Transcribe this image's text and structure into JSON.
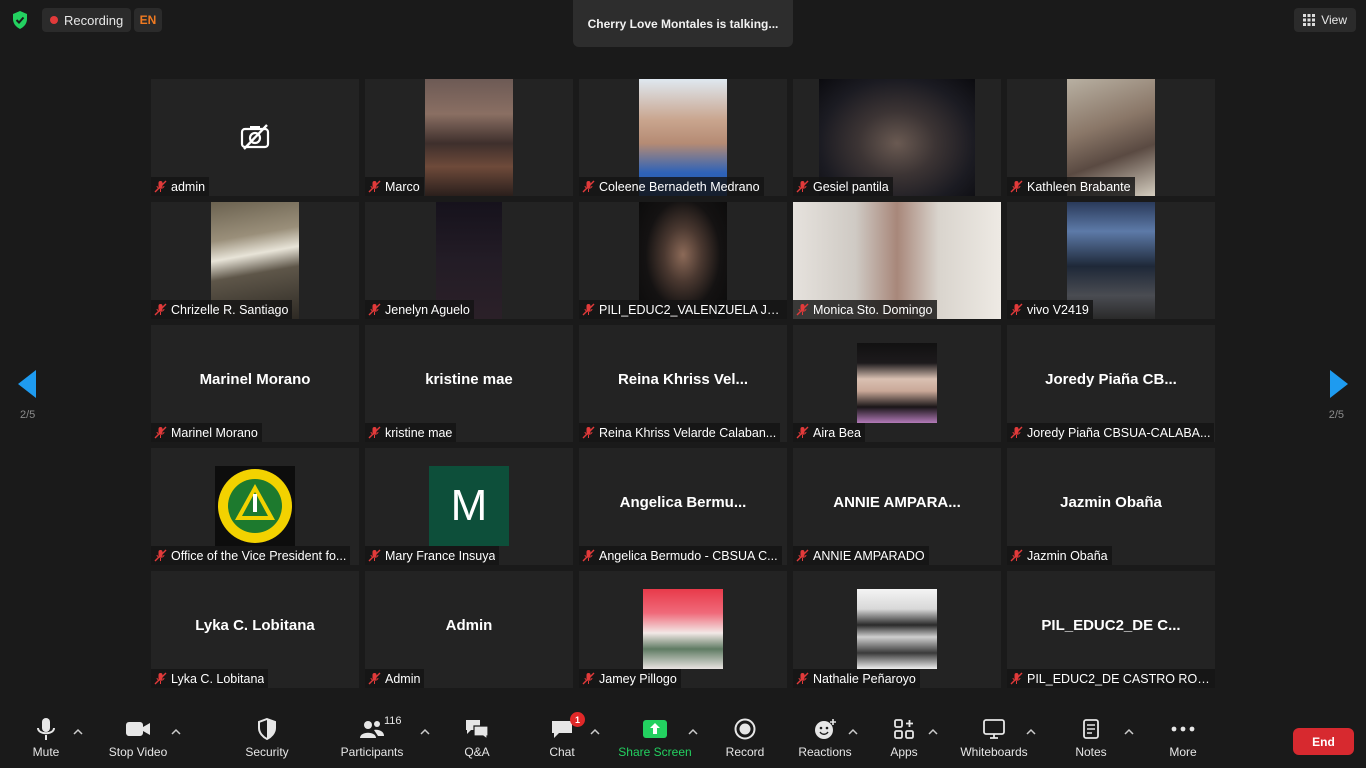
{
  "top": {
    "recording_label": "Recording",
    "language": "EN",
    "talking": "Cherry Love Montales is talking...",
    "view_label": "View"
  },
  "pagination": {
    "left": "2/5",
    "right": "2/5"
  },
  "tiles": [
    {
      "label": "admin"
    },
    {
      "label": "Marco"
    },
    {
      "label": "Coleene Bernadeth Medrano"
    },
    {
      "label": "Gesiel pantila"
    },
    {
      "label": "Kathleen Brabante"
    },
    {
      "label": "Chrizelle R. Santiago"
    },
    {
      "label": "Jenelyn Aguelo"
    },
    {
      "label": "PILI_EDUC2_VALENZUELA JHO..."
    },
    {
      "label": "Monica Sto. Domingo"
    },
    {
      "label": "vivo V2419"
    },
    {
      "big": "Marinel Morano",
      "label": "Marinel Morano"
    },
    {
      "big": "kristine mae",
      "label": "kristine mae"
    },
    {
      "big": "Reina Khriss Vel...",
      "label": "Reina Khriss Velarde Calaban..."
    },
    {
      "label": "Aira Bea"
    },
    {
      "big": "Joredy Piaña CB...",
      "label": "Joredy Piaña CBSUA-CALABA..."
    },
    {
      "label": "Office of the Vice President fo..."
    },
    {
      "avatar_letter": "M",
      "label": "Mary France Insuya"
    },
    {
      "big": "Angelica Bermu...",
      "label": "Angelica Bermudo - CBSUA C..."
    },
    {
      "big": "ANNIE AMPARA...",
      "label": "ANNIE AMPARADO"
    },
    {
      "big": "Jazmin Obaña",
      "label": "Jazmin Obaña"
    },
    {
      "big": "Lyka C. Lobitana",
      "label": "Lyka C. Lobitana"
    },
    {
      "big": "Admin",
      "label": "Admin"
    },
    {
      "label": "Jamey Pillogo"
    },
    {
      "label": "Nathalie Peñaroyo"
    },
    {
      "big": "PIL_EDUC2_DE C...",
      "label": "PIL_EDUC2_DE CASTRO RONA"
    }
  ],
  "toolbar": {
    "mute": "Mute",
    "stop_video": "Stop Video",
    "security": "Security",
    "participants": "Participants",
    "participants_count": "116",
    "qa": "Q&A",
    "chat": "Chat",
    "chat_badge": "1",
    "share_screen": "Share Screen",
    "record": "Record",
    "reactions": "Reactions",
    "apps": "Apps",
    "whiteboards": "Whiteboards",
    "notes": "Notes",
    "more": "More",
    "end": "End"
  },
  "colors": {
    "accent_green": "#23d160",
    "end_red": "#d7292f",
    "mic_off_red": "#e23a3a",
    "arrow_blue": "#1e9bf0"
  }
}
